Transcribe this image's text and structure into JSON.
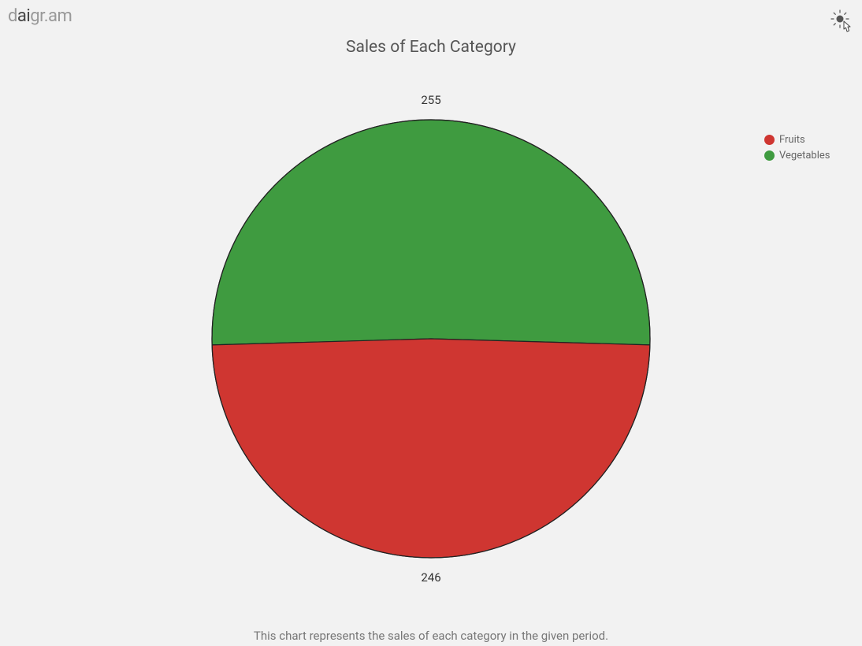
{
  "logo": {
    "pre": "d",
    "accent": "ai",
    "post": "gr.am"
  },
  "title": "Sales of Each Category",
  "caption": "This chart represents the sales of each category in the given period.",
  "legend": [
    {
      "label": "Fruits",
      "color": "#cf3631"
    },
    {
      "label": "Vegetables",
      "color": "#3f9b40"
    }
  ],
  "chart_data": {
    "type": "pie",
    "title": "Sales of Each Category",
    "series": [
      {
        "name": "Vegetables",
        "value": 255,
        "color": "#3f9b40"
      },
      {
        "name": "Fruits",
        "value": 246,
        "color": "#cf3631"
      }
    ],
    "labels": {
      "top": "255",
      "bottom": "246"
    }
  }
}
